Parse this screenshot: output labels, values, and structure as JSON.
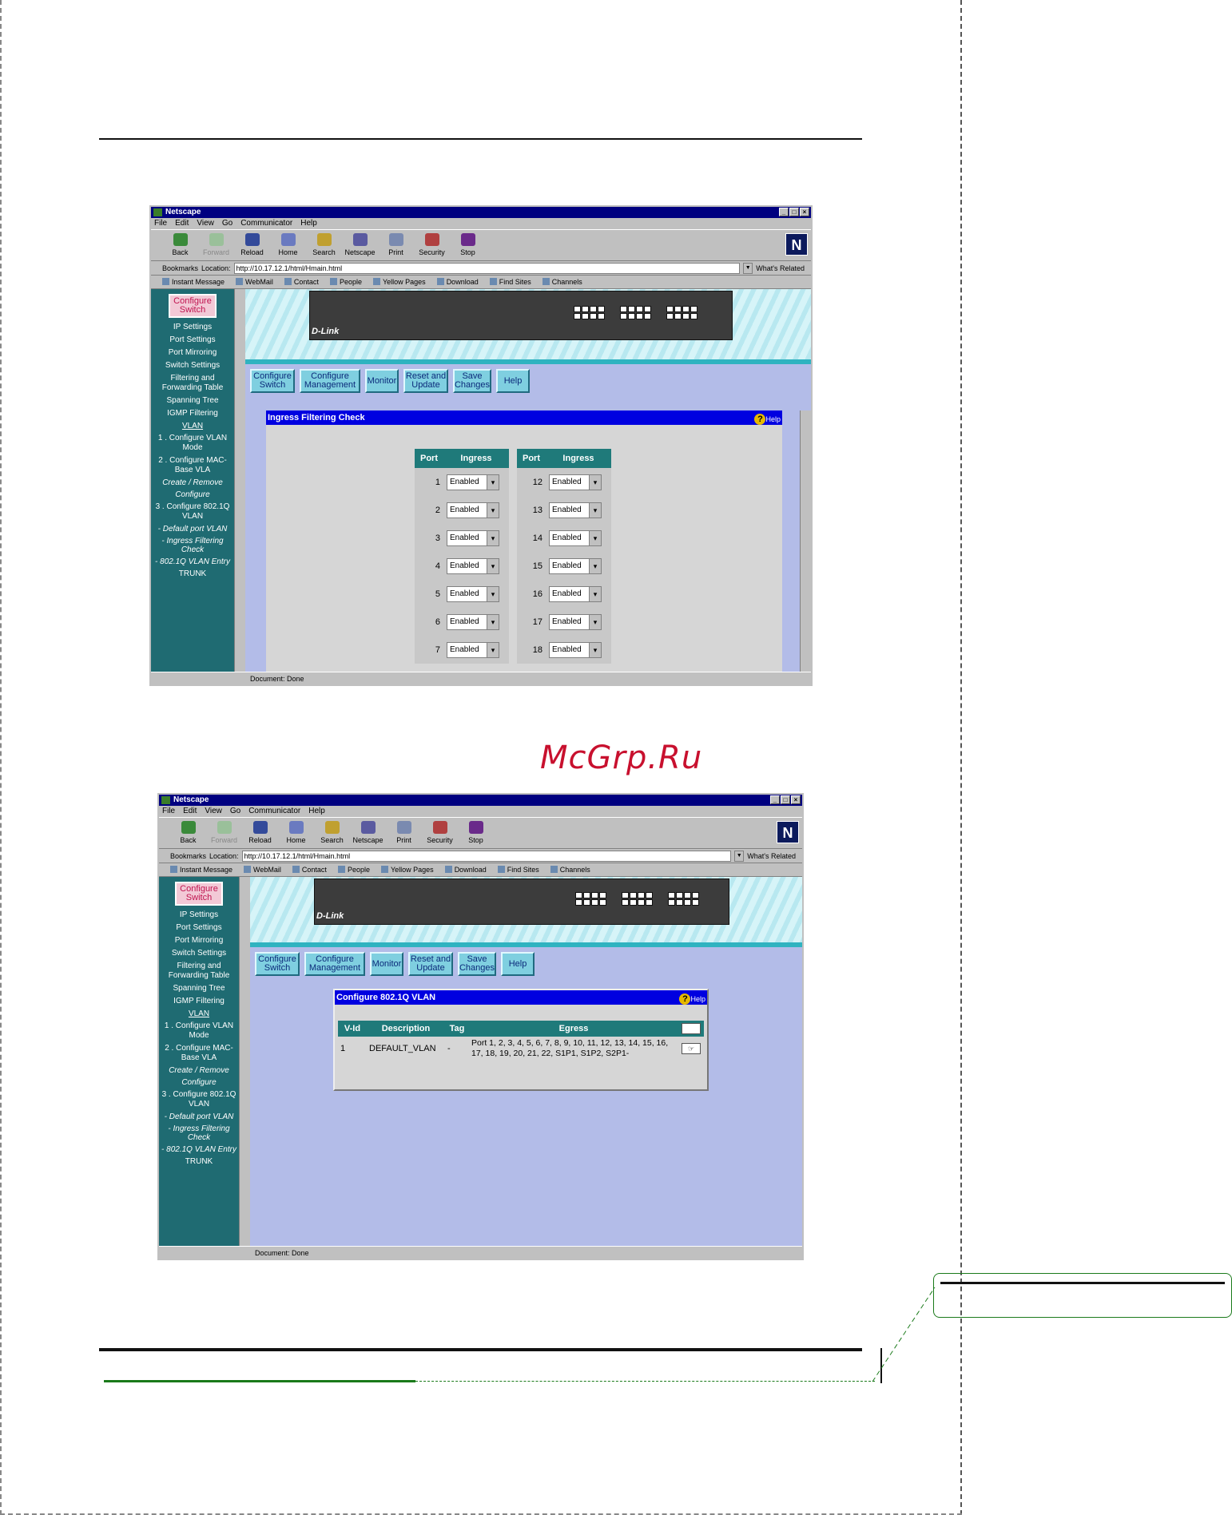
{
  "watermark": "McGrp.Ru",
  "windows": [
    {
      "title": "Netscape",
      "menu": [
        "File",
        "Edit",
        "View",
        "Go",
        "Communicator",
        "Help"
      ],
      "toolbar": [
        "Back",
        "Forward",
        "Reload",
        "Home",
        "Search",
        "Netscape",
        "Print",
        "Security",
        "Stop"
      ],
      "bookmarks_label": "Bookmarks",
      "location_label": "Location:",
      "url": "http://10.17.12.1/html/Hmain.html",
      "related": "What's Related",
      "personal": [
        "Instant Message",
        "WebMail",
        "Contact",
        "People",
        "Yellow Pages",
        "Download",
        "Find Sites",
        "Channels"
      ],
      "sidebar": {
        "badge": "Configure Switch",
        "items": [
          "IP Settings",
          "Port Settings",
          "Port Mirroring",
          "Switch Settings",
          "Filtering and Forwarding Table",
          "Spanning Tree",
          "IGMP Filtering"
        ],
        "vlan": "VLAN",
        "vlan_items": [
          "1 . Configure VLAN Mode",
          "2 . Configure MAC-Base VLA",
          "Create / Remove",
          "Configure",
          "3 . Configure 802.1Q VLAN",
          "- Default port VLAN",
          "- Ingress Filtering Check",
          "- 802.1Q VLAN Entry"
        ],
        "trunk": "TRUNK"
      },
      "nav": [
        "Configure Switch",
        "Configure Management",
        "Monitor",
        "Reset and Update",
        "Save Changes",
        "Help"
      ],
      "panel_title": "Ingress Filtering Check",
      "help": "Help",
      "col_port": "Port",
      "col_ingress": "Ingress",
      "left_ports": [
        "1",
        "2",
        "3",
        "4",
        "5",
        "6",
        "7"
      ],
      "right_ports": [
        "12",
        "13",
        "14",
        "15",
        "16",
        "17",
        "18"
      ],
      "ingress_value": "Enabled",
      "status": "Document: Done"
    },
    {
      "title": "Netscape",
      "menu": [
        "File",
        "Edit",
        "View",
        "Go",
        "Communicator",
        "Help"
      ],
      "toolbar": [
        "Back",
        "Forward",
        "Reload",
        "Home",
        "Search",
        "Netscape",
        "Print",
        "Security",
        "Stop"
      ],
      "bookmarks_label": "Bookmarks",
      "location_label": "Location:",
      "url": "http://10.17.12.1/html/Hmain.html",
      "related": "What's Related",
      "personal": [
        "Instant Message",
        "WebMail",
        "Contact",
        "People",
        "Yellow Pages",
        "Download",
        "Find Sites",
        "Channels"
      ],
      "sidebar": {
        "badge": "Configure Switch",
        "items": [
          "IP Settings",
          "Port Settings",
          "Port Mirroring",
          "Switch Settings",
          "Filtering and Forwarding Table",
          "Spanning Tree",
          "IGMP Filtering"
        ],
        "vlan": "VLAN",
        "vlan_items": [
          "1 . Configure VLAN Mode",
          "2 . Configure MAC-Base VLA",
          "Create / Remove",
          "Configure",
          "3 . Configure 802.1Q VLAN",
          "- Default port VLAN",
          "- Ingress Filtering Check",
          "- 802.1Q VLAN Entry"
        ],
        "trunk": "TRUNK"
      },
      "nav": [
        "Configure Switch",
        "Configure Management",
        "Monitor",
        "Reset and Update",
        "Save Changes",
        "Help"
      ],
      "panel_title": "Configure 802.1Q VLAN",
      "help": "Help",
      "headers": [
        "V-Id",
        "Description",
        "Tag",
        "Egress"
      ],
      "row": {
        "vid": "1",
        "description": "DEFAULT_VLAN",
        "tag": "-",
        "egress": "Port 1, 2, 3, 4, 5, 6, 7, 8, 9, 10, 11, 12, 13, 14, 15, 16, 17, 18, 19, 20, 21, 22, S1P1, S1P2, S2P1-"
      },
      "status": "Document: Done"
    }
  ]
}
